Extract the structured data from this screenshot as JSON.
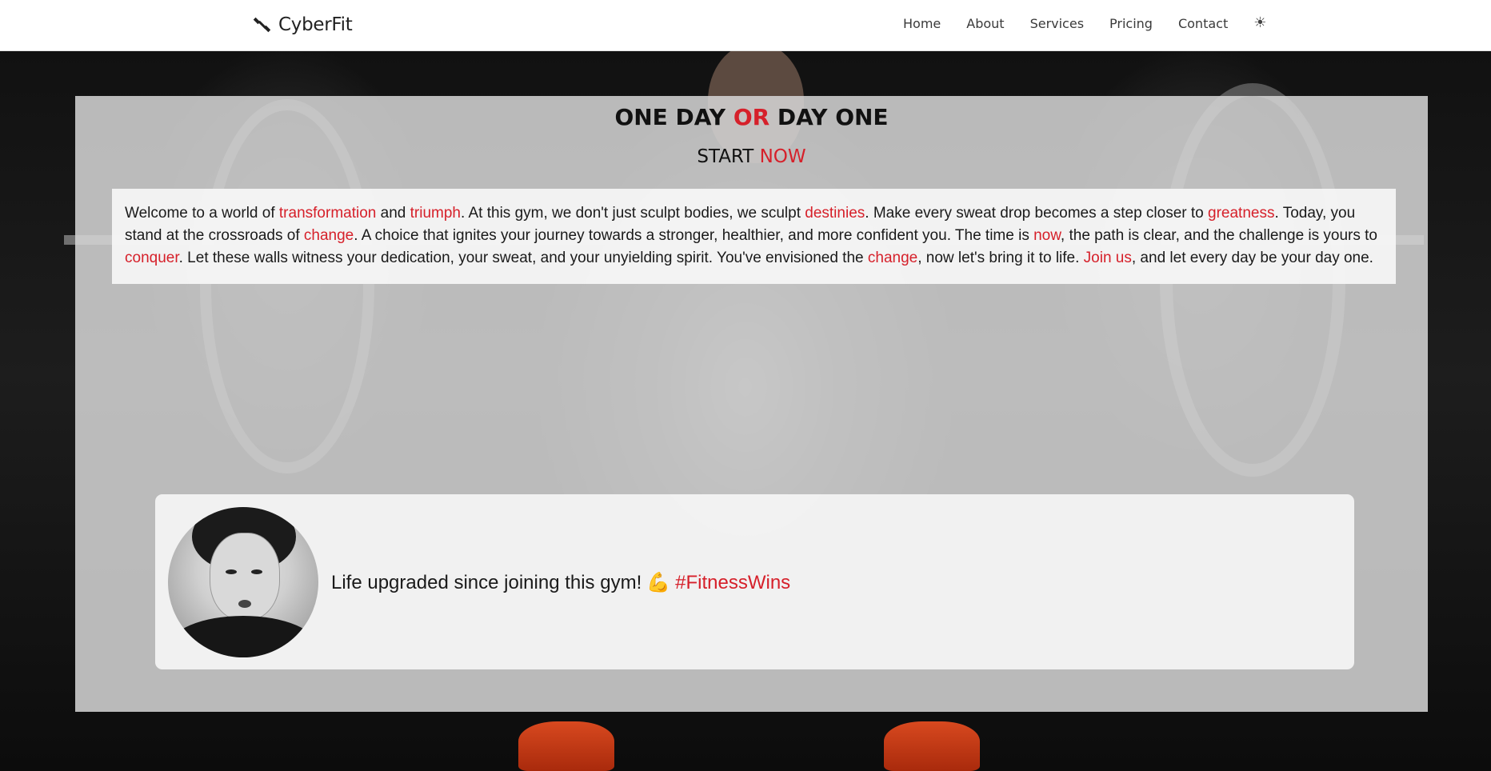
{
  "brand": {
    "name": "CyberFit",
    "logo_icon": "dumbbell-icon"
  },
  "nav": {
    "links": [
      {
        "label": "Home"
      },
      {
        "label": "About"
      },
      {
        "label": "Services"
      },
      {
        "label": "Pricing"
      },
      {
        "label": "Contact"
      }
    ],
    "theme_toggle": "☀"
  },
  "hero": {
    "headline": {
      "part1": "ONE DAY ",
      "accent": "OR",
      "part2": " DAY ONE"
    },
    "subheadline": {
      "part1": "START ",
      "accent": "NOW"
    },
    "intro": {
      "t1": "Welcome to a world of ",
      "h1": "transformation",
      "t2": " and ",
      "h2": "triumph",
      "t3": ". At this gym, we don't just sculpt bodies, we sculpt ",
      "h3": "destinies",
      "t4": ". Make every sweat drop becomes a step closer to ",
      "h4": "greatness",
      "t5": ". Today, you stand at the crossroads of ",
      "h5": "change",
      "t6": ". A choice that ignites your journey towards a stronger, healthier, and more confident you. The time is ",
      "h6": "now",
      "t7": ", the path is clear, and the challenge is yours to ",
      "h7": "conquer",
      "t8": ". Let these walls witness your dedication, your sweat, and your unyielding spirit. You've envisioned the ",
      "h8": "change",
      "t9": ", now let's bring it to life. ",
      "h9": "Join us",
      "t10": ", and let every day be your day one."
    }
  },
  "testimonial": {
    "text": "Life upgraded since joining this gym!",
    "emoji": "💪",
    "hashtag": "#FitnessWins"
  },
  "colors": {
    "accent": "#d6202a",
    "panel": "#d6d6d6",
    "navbar": "#ffffff"
  }
}
